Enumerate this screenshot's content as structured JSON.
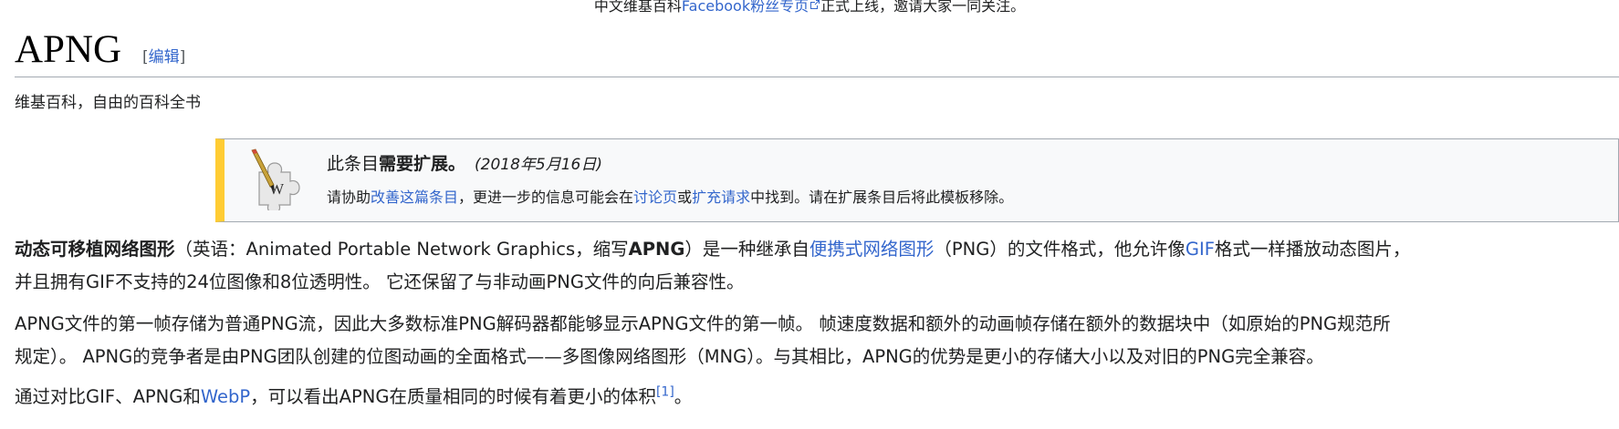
{
  "site_notice": {
    "before": "中文维基百科",
    "link": "Facebook粉丝专页",
    "after": "正式上线，邀请大家一同关注。"
  },
  "heading": {
    "title": "APNG",
    "edit_open": "[",
    "edit_label": "编辑",
    "edit_close": "]"
  },
  "tagline": "维基百科，自由的百科全书",
  "ambox": {
    "title_prefix": "此条目",
    "title_bold": "需要扩展。",
    "date": "(2018年5月16日)",
    "body_1": "请协助",
    "link_improve": "改善这篇条目",
    "body_2": "，更进一步的信息可能会在",
    "link_talk": "讨论页",
    "body_3": "或",
    "link_request": "扩充请求",
    "body_4": "中找到。请在扩展条目后将此模板移除。",
    "accent_color": "#ffcc33"
  },
  "paragraphs": {
    "p1": {
      "bold_1": "动态可移植网络图形",
      "t1": "（英语：Animated Portable Network Graphics，缩写",
      "bold_2": "APNG",
      "t2": "）是一种继承自",
      "link_png": "便携式网络图形",
      "t3": "（PNG）的文件格式，他允许像",
      "link_gif": "GIF",
      "t4": "格式一样播放动态图片，",
      "line2": "并且拥有GIF不支持的24位图像和8位透明性。 它还保留了与非动画PNG文件的向后兼容性。"
    },
    "p2": {
      "line1": "APNG文件的第一帧存储为普通PNG流，因此大多数标准PNG解码器都能够显示APNG文件的第一帧。 帧速度数据和额外的动画帧存储在额外的数据块中（如原始的PNG规范所",
      "line2": "规定）。 APNG的竞争者是由PNG团队创建的位图动画的全面格式——多图像网络图形（MNG）。与其相比，APNG的优势是更小的存储大小以及对旧的PNG完全兼容。"
    },
    "p3": {
      "t1": "通过对比GIF、APNG和",
      "link_webp": "WebP",
      "t2": "，可以看出APNG在质量相同的时候有着更小的体积",
      "ref": "[1]",
      "t3": "。"
    }
  },
  "colors": {
    "link": "#3366cc",
    "text": "#202122",
    "border": "#a2a9b1"
  }
}
